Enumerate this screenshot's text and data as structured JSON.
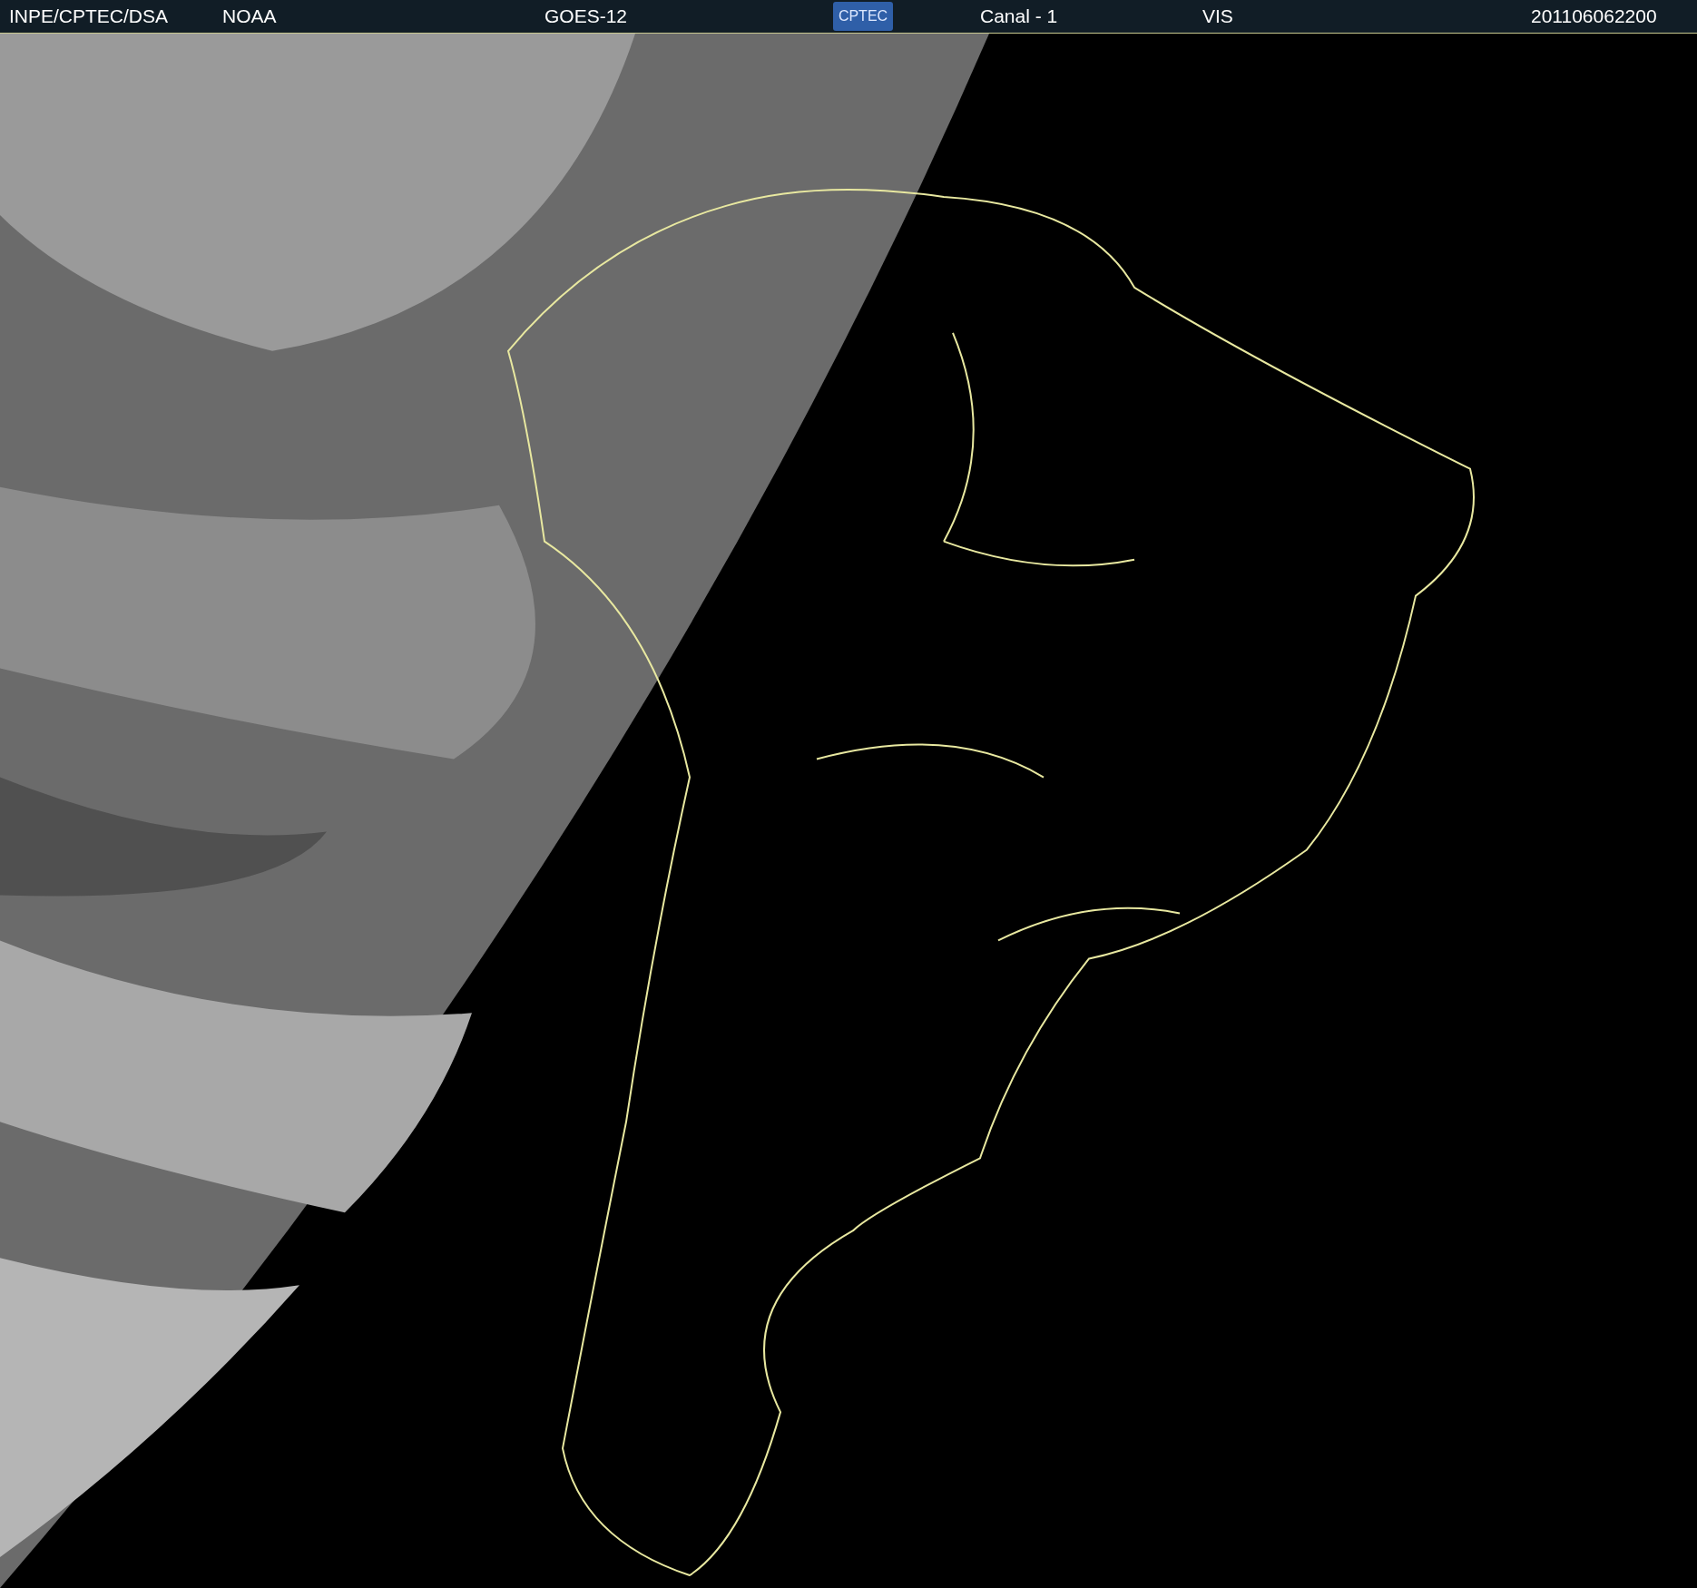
{
  "header": {
    "institution": "INPE/CPTEC/DSA",
    "agency": "NOAA",
    "satellite": "GOES-12",
    "logo": "CPTEC",
    "channel": "Canal - 1",
    "band": "VIS",
    "timestamp": "201106062200"
  }
}
